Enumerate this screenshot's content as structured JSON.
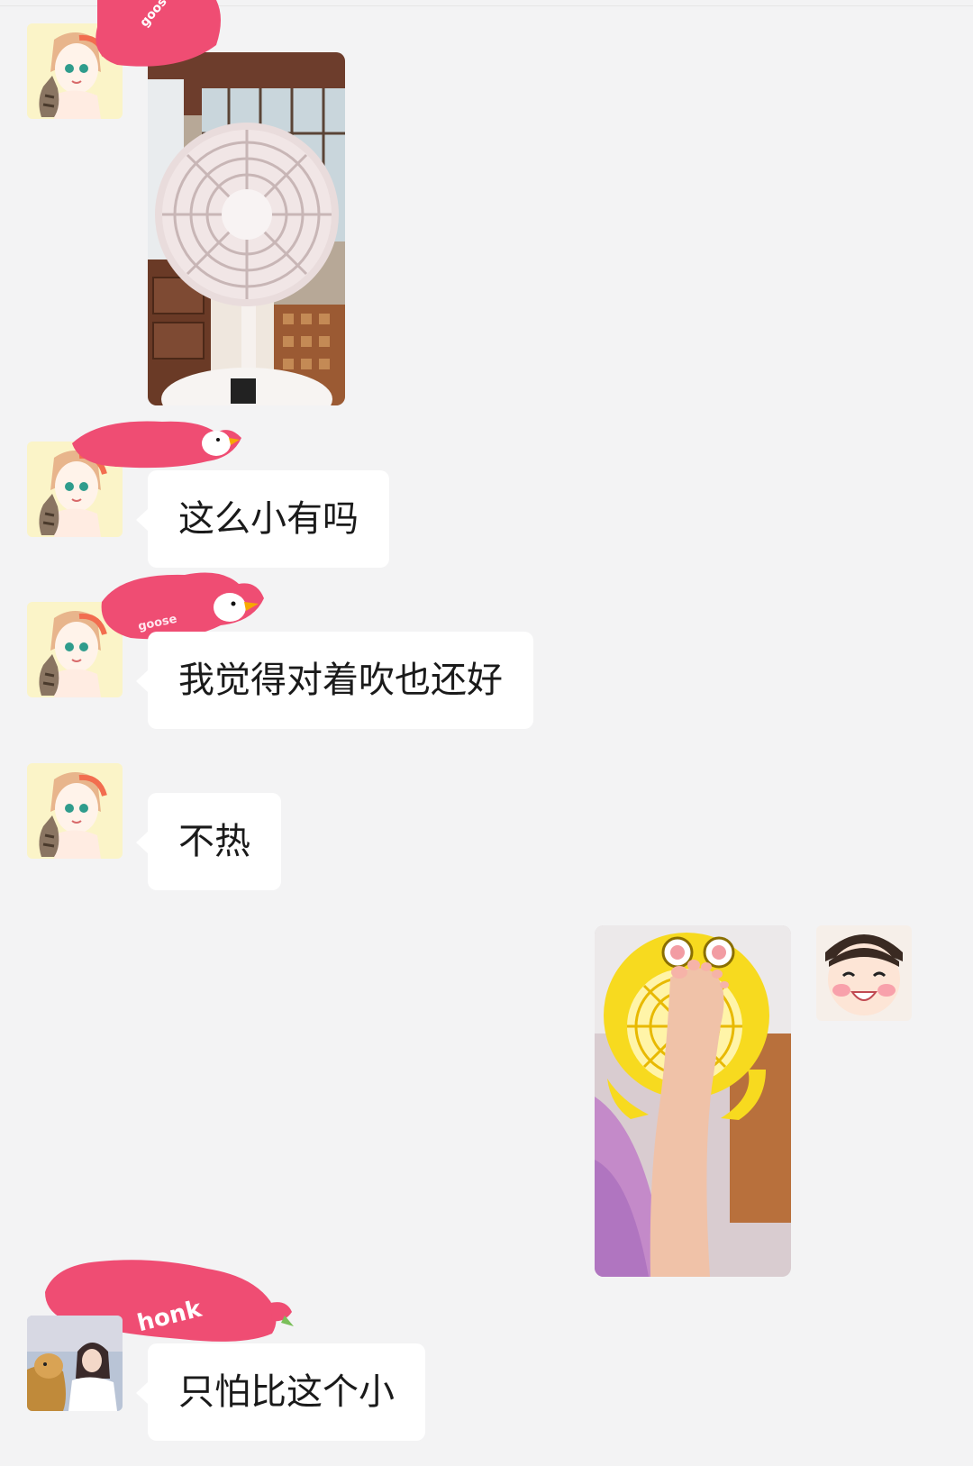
{
  "conversation": {
    "messages": [
      {
        "sender": "contact",
        "type": "image",
        "image": "white-pedestal-fan-photo"
      },
      {
        "sender": "contact",
        "type": "text",
        "text": "这么小有吗"
      },
      {
        "sender": "contact",
        "type": "text",
        "text": "我觉得对着吹也还好"
      },
      {
        "sender": "contact",
        "type": "text",
        "text": "不热"
      },
      {
        "sender": "self",
        "type": "image",
        "image": "yellow-mini-fan-with-foot-photo"
      },
      {
        "sender": "contact-2",
        "type": "text",
        "text": "只怕比这个小"
      }
    ]
  },
  "stickers": {
    "goose_label": "goose",
    "honk_label": "honk"
  },
  "colors": {
    "background": "#f3f3f4",
    "bubble": "#ffffff",
    "text": "#1a1a1a",
    "redaction_sticker": "#ef4d73"
  }
}
